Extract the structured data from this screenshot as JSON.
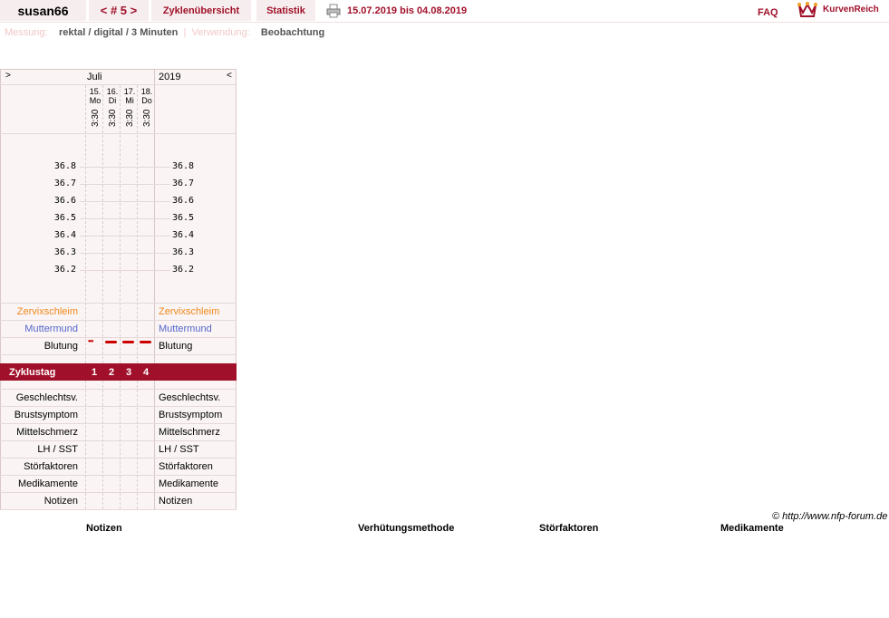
{
  "header": {
    "user": "susan66",
    "cycle": "< # 5 >",
    "tabs": [
      "Zyklenübersicht",
      "Statistik"
    ],
    "period": "15.07.2019 bis 04.08.2019",
    "faq": "FAQ",
    "logo_text": "KurvenReich",
    "colors": {
      "accent": "#a0102a",
      "tab_bg": "#f6eeee"
    }
  },
  "info": {
    "measurement_label": "Messung:",
    "measurement_value": "rektal / digital / 3 Minuten",
    "separator": "|",
    "usage_label": "Verwendung:",
    "usage_value": "Beobachtung"
  },
  "chart": {
    "prev": ">",
    "next": "<",
    "month": "Juli",
    "year": "2019",
    "days": [
      {
        "date": "15.",
        "weekday": "Mo",
        "time": "3:30",
        "cycle_day": "1"
      },
      {
        "date": "16.",
        "weekday": "Di",
        "time": "3:30",
        "cycle_day": "2"
      },
      {
        "date": "17.",
        "weekday": "Mi",
        "time": "3:30",
        "cycle_day": "3"
      },
      {
        "date": "18.",
        "weekday": "Do",
        "time": "3:30",
        "cycle_day": "4"
      }
    ],
    "temperatures": [
      "36.8",
      "36.7",
      "36.6",
      "36.5",
      "36.4",
      "36.3",
      "36.2"
    ],
    "rows": {
      "mucus": "Zervixschleim",
      "cervix": "Muttermund",
      "bleeding": "Blutung",
      "cycle_day": "Zyklustag",
      "intercourse": "Geschlechtsv.",
      "breast": "Brustsymptom",
      "midpain": "Mittelschmerz",
      "lh": "LH / SST",
      "disturb": "Störfaktoren",
      "meds": "Medikamente",
      "notes": "Notizen"
    },
    "bleeding_marks": [
      "light-dots",
      "dash",
      "dash",
      "dash"
    ]
  },
  "footer": {
    "copyright": "© http://www.nfp-forum.de",
    "columns": [
      "Notizen",
      "Verhütungsmethode",
      "Störfaktoren",
      "Medikamente"
    ]
  }
}
